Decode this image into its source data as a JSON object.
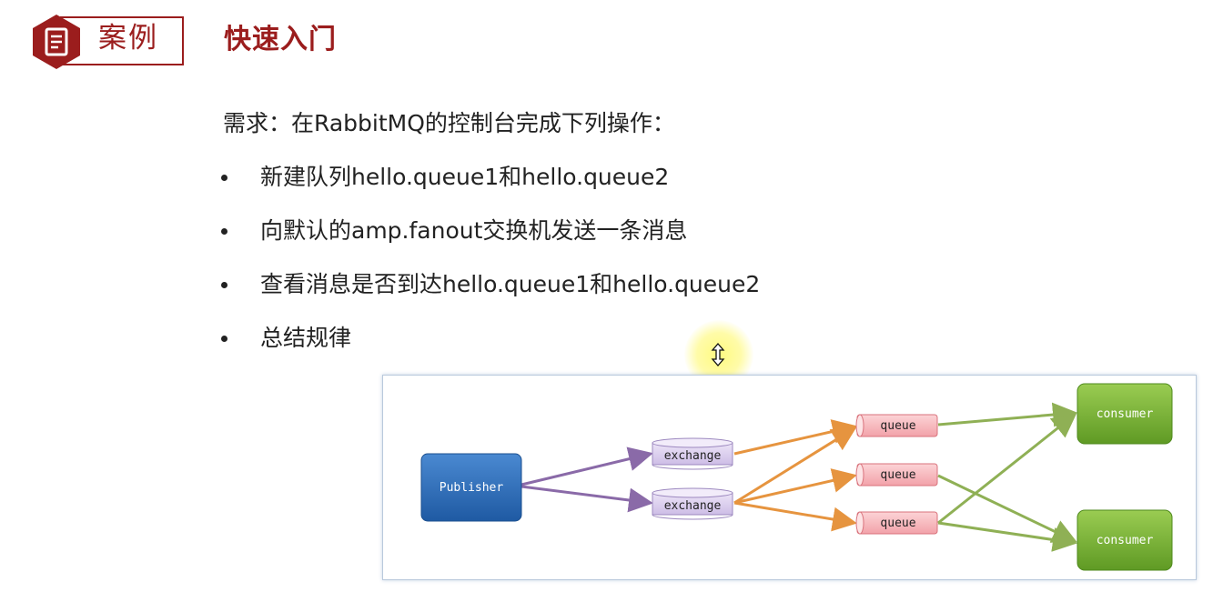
{
  "header": {
    "badge_label": "案例",
    "title": "快速入门",
    "badge_icon": "document-icon",
    "accent_color": "#9b1d1d"
  },
  "content": {
    "requirement": "需求：在RabbitMQ的控制台完成下列操作：",
    "bullets": [
      "新建队列hello.queue1和hello.queue2",
      "向默认的amp.fanout交换机发送一条消息",
      "查看消息是否到达hello.queue1和hello.queue2",
      "总结规律"
    ]
  },
  "cursor": {
    "icon": "resize-vertical-icon"
  },
  "diagram": {
    "publisher": "Publisher",
    "exchanges": [
      "exchange",
      "exchange"
    ],
    "queues": [
      "queue",
      "queue",
      "queue"
    ],
    "consumers": [
      "consumer",
      "consumer"
    ],
    "colors": {
      "publisher": "#2f6db8",
      "exchange": "#dcd0ee",
      "queue": "#f7b8bd",
      "consumer": "#7fb437",
      "publisher_edge": "#8a6aa8",
      "exchange_edge": "#e6943f",
      "queue_edge": "#8fb055"
    }
  }
}
